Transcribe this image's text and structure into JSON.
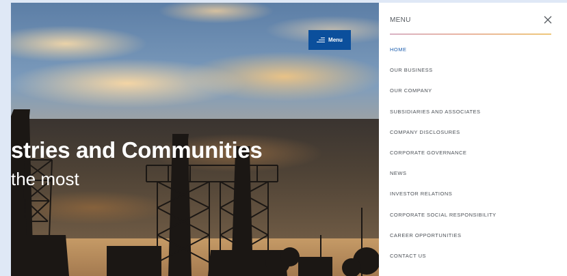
{
  "hero": {
    "title": "stries and Communities",
    "subtitle": "the most",
    "menu_button_label": "Menu"
  },
  "panel": {
    "title": "MENU",
    "close_icon": "close-icon",
    "items": [
      {
        "label": "HOME",
        "active": true
      },
      {
        "label": "OUR BUSINESS",
        "active": false
      },
      {
        "label": "OUR COMPANY",
        "active": false
      },
      {
        "label": "SUBSIDIARIES AND ASSOCIATES",
        "active": false
      },
      {
        "label": "COMPANY DISCLOSURES",
        "active": false
      },
      {
        "label": "CORPORATE GOVERNANCE",
        "active": false
      },
      {
        "label": "NEWS",
        "active": false
      },
      {
        "label": "INVESTOR RELATIONS",
        "active": false
      },
      {
        "label": "CORPORATE SOCIAL RESPONSIBILITY",
        "active": false
      },
      {
        "label": "CAREER OPPORTUNITIES",
        "active": false
      },
      {
        "label": "CONTACT US",
        "active": false
      }
    ]
  },
  "colors": {
    "brand_blue": "#0b4f9c",
    "active_link": "#1e5fae",
    "page_background": "#dfe8f6"
  }
}
